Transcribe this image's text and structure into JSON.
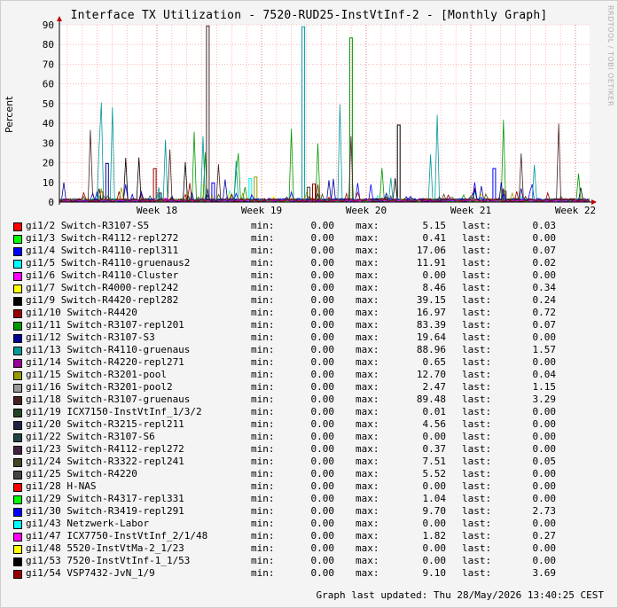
{
  "title": "Interface TX Utilization - 7520-RUD25-InstVtInf-2 - [Monthly Graph]",
  "watermark": "RRDTOOL / TOBI OETIKER",
  "updated": "Graph last updated: Thu 28/May/2026 13:40:25 CEST",
  "labels": {
    "min": "min:",
    "max": "max:",
    "last": "last:"
  },
  "chart_data": {
    "type": "line",
    "title": "Interface TX Utilization - 7520-RUD25-InstVtInf-2 - [Monthly Graph]",
    "ylabel": "Percent",
    "xlabel": "",
    "ylim": [
      0,
      90
    ],
    "yticks": [
      0,
      10,
      20,
      30,
      40,
      50,
      60,
      70,
      80,
      90
    ],
    "xticks": [
      "Week 18",
      "Week 19",
      "Week 20",
      "Week 21",
      "Week 22"
    ],
    "grid": true,
    "series": [
      {
        "name": "gi1/2 Switch-R3107-S5",
        "color": "#ff0000",
        "min": "0.00",
        "max": "5.15",
        "last": "0.03"
      },
      {
        "name": "gi1/3 Switch-R4112-repl272",
        "color": "#00ff00",
        "min": "0.00",
        "max": "0.41",
        "last": "0.00"
      },
      {
        "name": "gi1/4 Switch-R4110-repl311",
        "color": "#0000ff",
        "min": "0.00",
        "max": "17.06",
        "last": "0.07"
      },
      {
        "name": "gi1/5 Switch-R4110-gruenaus2",
        "color": "#00ffff",
        "min": "0.00",
        "max": "11.91",
        "last": "0.02"
      },
      {
        "name": "gi1/6 Switch-R4110-Cluster",
        "color": "#ff00ff",
        "min": "0.00",
        "max": "0.00",
        "last": "0.00"
      },
      {
        "name": "gi1/7 Switch-R4000-repl242",
        "color": "#ffff00",
        "min": "0.00",
        "max": "8.46",
        "last": "0.34"
      },
      {
        "name": "gi1/9 Switch-R4420-repl282",
        "color": "#000000",
        "min": "0.00",
        "max": "39.15",
        "last": "0.24"
      },
      {
        "name": "gi1/10 Switch-R4420",
        "color": "#990000",
        "min": "0.00",
        "max": "16.97",
        "last": "0.72"
      },
      {
        "name": "gi1/11 Switch-R3107-repl201",
        "color": "#009900",
        "min": "0.00",
        "max": "83.39",
        "last": "0.07"
      },
      {
        "name": "gi1/12 Switch-R3107-S3",
        "color": "#000099",
        "min": "0.00",
        "max": "19.64",
        "last": "0.00"
      },
      {
        "name": "gi1/13 Switch-R4110-gruenaus",
        "color": "#009999",
        "min": "0.00",
        "max": "88.96",
        "last": "1.57"
      },
      {
        "name": "gi1/14 Switch-R4220-repl271",
        "color": "#990099",
        "min": "0.00",
        "max": "0.65",
        "last": "0.00"
      },
      {
        "name": "gi1/15 Switch-R3201-pool",
        "color": "#999900",
        "min": "0.00",
        "max": "12.70",
        "last": "0.04"
      },
      {
        "name": "gi1/16 Switch-R3201-pool2",
        "color": "#999999",
        "min": "0.00",
        "max": "2.47",
        "last": "1.15"
      },
      {
        "name": "gi1/18 Switch-R3107-gruenaus",
        "color": "#442222",
        "min": "0.00",
        "max": "89.48",
        "last": "3.29"
      },
      {
        "name": "gi1/19 ICX7150-InstVtInf_1/3/2",
        "color": "#224422",
        "min": "0.00",
        "max": "0.01",
        "last": "0.00"
      },
      {
        "name": "gi1/20 Switch-R3215-repl211",
        "color": "#222244",
        "min": "0.00",
        "max": "4.56",
        "last": "0.00"
      },
      {
        "name": "gi1/22 Switch-R3107-S6",
        "color": "#224444",
        "min": "0.00",
        "max": "0.00",
        "last": "0.00"
      },
      {
        "name": "gi1/23 Switch-R4112-repl272",
        "color": "#442244",
        "min": "0.00",
        "max": "0.37",
        "last": "0.00"
      },
      {
        "name": "gi1/24 Switch-R3322-repl241",
        "color": "#444422",
        "min": "0.00",
        "max": "7.51",
        "last": "0.05"
      },
      {
        "name": "gi1/25 Switch-R4220",
        "color": "#444444",
        "min": "0.00",
        "max": "5.52",
        "last": "0.00"
      },
      {
        "name": "gi1/28 H-NAS",
        "color": "#ff0000",
        "min": "0.00",
        "max": "0.00",
        "last": "0.00"
      },
      {
        "name": "gi1/29 Switch-R4317-repl331",
        "color": "#00ff00",
        "min": "0.00",
        "max": "1.04",
        "last": "0.00"
      },
      {
        "name": "gi1/30 Switch-R3419-repl291",
        "color": "#0000ff",
        "min": "0.00",
        "max": "9.70",
        "last": "2.73"
      },
      {
        "name": "gi1/43 Netzwerk-Labor",
        "color": "#00ffff",
        "min": "0.00",
        "max": "0.00",
        "last": "0.00"
      },
      {
        "name": "gi1/47 ICX7750-InstVtInf_2/1/48",
        "color": "#ff00ff",
        "min": "0.00",
        "max": "1.82",
        "last": "0.27"
      },
      {
        "name": "gi1/48 5520-InstVtMa-2_1/23",
        "color": "#ffff00",
        "min": "0.00",
        "max": "0.00",
        "last": "0.00"
      },
      {
        "name": "gi1/53 7520-InstVtInf-1_1/53",
        "color": "#000000",
        "min": "0.00",
        "max": "0.00",
        "last": "0.00"
      },
      {
        "name": "gi1/54 VSP7432-JvN_1/9",
        "color": "#990000",
        "min": "0.00",
        "max": "9.10",
        "last": "3.69"
      }
    ]
  }
}
